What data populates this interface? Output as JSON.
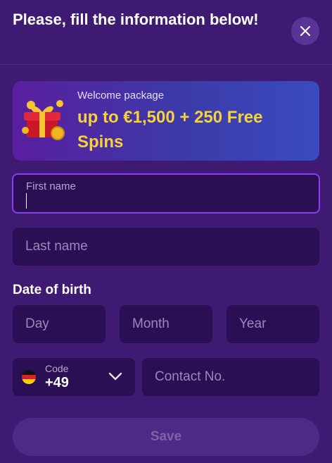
{
  "header": {
    "title": "Please, fill the information below!",
    "close_icon": "close-icon"
  },
  "banner": {
    "subtitle": "Welcome package",
    "offer": "up to €1,500 + 250 Free Spins",
    "image_icon": "gift-box-icon",
    "offer_color": "#f7d13a"
  },
  "form": {
    "first_name": {
      "label": "First name",
      "value": ""
    },
    "last_name": {
      "placeholder": "Last name"
    },
    "dob": {
      "label": "Date of birth",
      "day": "Day",
      "month": "Month",
      "year": "Year"
    },
    "phone": {
      "code_label": "Code",
      "code_value": "+49",
      "flag_icon": "germany-flag-icon",
      "contact_placeholder": "Contact No."
    },
    "save_label": "Save"
  },
  "colors": {
    "background": "#3e1a73",
    "field_bg": "#2a0f55",
    "focus_border": "#8c3df0",
    "accent": "#f7d13a"
  }
}
